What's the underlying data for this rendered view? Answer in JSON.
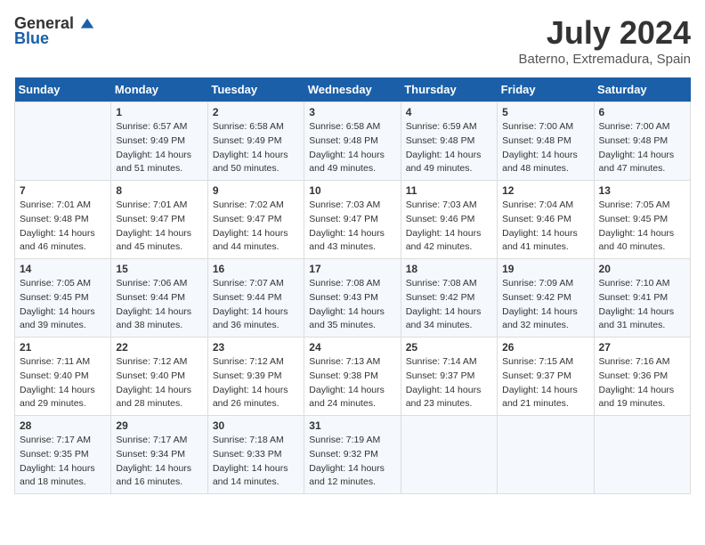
{
  "header": {
    "logo_general": "General",
    "logo_blue": "Blue",
    "month_year": "July 2024",
    "location": "Baterno, Extremadura, Spain"
  },
  "weekdays": [
    "Sunday",
    "Monday",
    "Tuesday",
    "Wednesday",
    "Thursday",
    "Friday",
    "Saturday"
  ],
  "weeks": [
    [
      {
        "day": "",
        "info": ""
      },
      {
        "day": "1",
        "info": "Sunrise: 6:57 AM\nSunset: 9:49 PM\nDaylight: 14 hours\nand 51 minutes."
      },
      {
        "day": "2",
        "info": "Sunrise: 6:58 AM\nSunset: 9:49 PM\nDaylight: 14 hours\nand 50 minutes."
      },
      {
        "day": "3",
        "info": "Sunrise: 6:58 AM\nSunset: 9:48 PM\nDaylight: 14 hours\nand 49 minutes."
      },
      {
        "day": "4",
        "info": "Sunrise: 6:59 AM\nSunset: 9:48 PM\nDaylight: 14 hours\nand 49 minutes."
      },
      {
        "day": "5",
        "info": "Sunrise: 7:00 AM\nSunset: 9:48 PM\nDaylight: 14 hours\nand 48 minutes."
      },
      {
        "day": "6",
        "info": "Sunrise: 7:00 AM\nSunset: 9:48 PM\nDaylight: 14 hours\nand 47 minutes."
      }
    ],
    [
      {
        "day": "7",
        "info": "Sunrise: 7:01 AM\nSunset: 9:48 PM\nDaylight: 14 hours\nand 46 minutes."
      },
      {
        "day": "8",
        "info": "Sunrise: 7:01 AM\nSunset: 9:47 PM\nDaylight: 14 hours\nand 45 minutes."
      },
      {
        "day": "9",
        "info": "Sunrise: 7:02 AM\nSunset: 9:47 PM\nDaylight: 14 hours\nand 44 minutes."
      },
      {
        "day": "10",
        "info": "Sunrise: 7:03 AM\nSunset: 9:47 PM\nDaylight: 14 hours\nand 43 minutes."
      },
      {
        "day": "11",
        "info": "Sunrise: 7:03 AM\nSunset: 9:46 PM\nDaylight: 14 hours\nand 42 minutes."
      },
      {
        "day": "12",
        "info": "Sunrise: 7:04 AM\nSunset: 9:46 PM\nDaylight: 14 hours\nand 41 minutes."
      },
      {
        "day": "13",
        "info": "Sunrise: 7:05 AM\nSunset: 9:45 PM\nDaylight: 14 hours\nand 40 minutes."
      }
    ],
    [
      {
        "day": "14",
        "info": "Sunrise: 7:05 AM\nSunset: 9:45 PM\nDaylight: 14 hours\nand 39 minutes."
      },
      {
        "day": "15",
        "info": "Sunrise: 7:06 AM\nSunset: 9:44 PM\nDaylight: 14 hours\nand 38 minutes."
      },
      {
        "day": "16",
        "info": "Sunrise: 7:07 AM\nSunset: 9:44 PM\nDaylight: 14 hours\nand 36 minutes."
      },
      {
        "day": "17",
        "info": "Sunrise: 7:08 AM\nSunset: 9:43 PM\nDaylight: 14 hours\nand 35 minutes."
      },
      {
        "day": "18",
        "info": "Sunrise: 7:08 AM\nSunset: 9:42 PM\nDaylight: 14 hours\nand 34 minutes."
      },
      {
        "day": "19",
        "info": "Sunrise: 7:09 AM\nSunset: 9:42 PM\nDaylight: 14 hours\nand 32 minutes."
      },
      {
        "day": "20",
        "info": "Sunrise: 7:10 AM\nSunset: 9:41 PM\nDaylight: 14 hours\nand 31 minutes."
      }
    ],
    [
      {
        "day": "21",
        "info": "Sunrise: 7:11 AM\nSunset: 9:40 PM\nDaylight: 14 hours\nand 29 minutes."
      },
      {
        "day": "22",
        "info": "Sunrise: 7:12 AM\nSunset: 9:40 PM\nDaylight: 14 hours\nand 28 minutes."
      },
      {
        "day": "23",
        "info": "Sunrise: 7:12 AM\nSunset: 9:39 PM\nDaylight: 14 hours\nand 26 minutes."
      },
      {
        "day": "24",
        "info": "Sunrise: 7:13 AM\nSunset: 9:38 PM\nDaylight: 14 hours\nand 24 minutes."
      },
      {
        "day": "25",
        "info": "Sunrise: 7:14 AM\nSunset: 9:37 PM\nDaylight: 14 hours\nand 23 minutes."
      },
      {
        "day": "26",
        "info": "Sunrise: 7:15 AM\nSunset: 9:37 PM\nDaylight: 14 hours\nand 21 minutes."
      },
      {
        "day": "27",
        "info": "Sunrise: 7:16 AM\nSunset: 9:36 PM\nDaylight: 14 hours\nand 19 minutes."
      }
    ],
    [
      {
        "day": "28",
        "info": "Sunrise: 7:17 AM\nSunset: 9:35 PM\nDaylight: 14 hours\nand 18 minutes."
      },
      {
        "day": "29",
        "info": "Sunrise: 7:17 AM\nSunset: 9:34 PM\nDaylight: 14 hours\nand 16 minutes."
      },
      {
        "day": "30",
        "info": "Sunrise: 7:18 AM\nSunset: 9:33 PM\nDaylight: 14 hours\nand 14 minutes."
      },
      {
        "day": "31",
        "info": "Sunrise: 7:19 AM\nSunset: 9:32 PM\nDaylight: 14 hours\nand 12 minutes."
      },
      {
        "day": "",
        "info": ""
      },
      {
        "day": "",
        "info": ""
      },
      {
        "day": "",
        "info": ""
      }
    ]
  ]
}
